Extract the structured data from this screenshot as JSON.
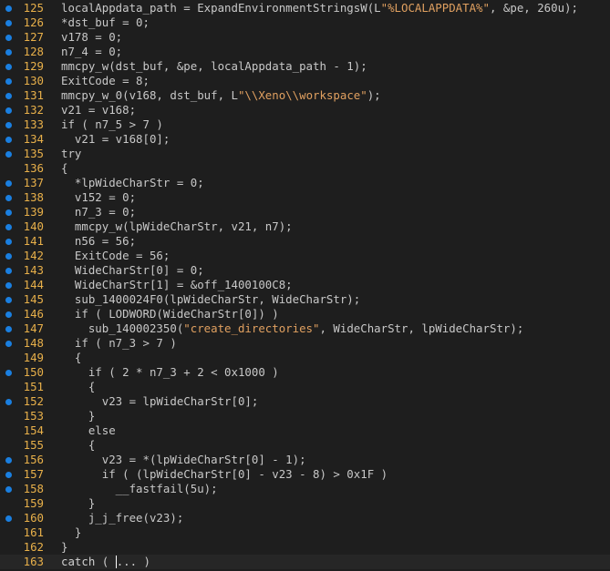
{
  "editor": {
    "lines": [
      {
        "n": "125",
        "bp": true,
        "code": "localAppdata_path = ExpandEnvironmentStringsW(L\"%LOCALAPPDATA%\", &pe, 260u);"
      },
      {
        "n": "126",
        "bp": true,
        "code": "*dst_buf = 0;"
      },
      {
        "n": "127",
        "bp": true,
        "code": "v178 = 0;"
      },
      {
        "n": "128",
        "bp": true,
        "code": "n7_4 = 0;"
      },
      {
        "n": "129",
        "bp": true,
        "code": "mmcpy_w(dst_buf, &pe, localAppdata_path - 1);"
      },
      {
        "n": "130",
        "bp": true,
        "code": "ExitCode = 8;"
      },
      {
        "n": "131",
        "bp": true,
        "code": "mmcpy_w_0(v168, dst_buf, L\"\\\\Xeno\\\\workspace\");"
      },
      {
        "n": "132",
        "bp": true,
        "code": "v21 = v168;"
      },
      {
        "n": "133",
        "bp": true,
        "code": "if ( n7_5 > 7 )"
      },
      {
        "n": "134",
        "bp": true,
        "code": "  v21 = v168[0];"
      },
      {
        "n": "135",
        "bp": true,
        "code": "try"
      },
      {
        "n": "136",
        "bp": false,
        "code": "{"
      },
      {
        "n": "137",
        "bp": true,
        "code": "  *lpWideCharStr = 0;"
      },
      {
        "n": "138",
        "bp": true,
        "code": "  v152 = 0;"
      },
      {
        "n": "139",
        "bp": true,
        "code": "  n7_3 = 0;"
      },
      {
        "n": "140",
        "bp": true,
        "code": "  mmcpy_w(lpWideCharStr, v21, n7);"
      },
      {
        "n": "141",
        "bp": true,
        "code": "  n56 = 56;"
      },
      {
        "n": "142",
        "bp": true,
        "code": "  ExitCode = 56;"
      },
      {
        "n": "143",
        "bp": true,
        "code": "  WideCharStr[0] = 0;"
      },
      {
        "n": "144",
        "bp": true,
        "code": "  WideCharStr[1] = &off_1400100C8;"
      },
      {
        "n": "145",
        "bp": true,
        "code": "  sub_1400024F0(lpWideCharStr, WideCharStr);"
      },
      {
        "n": "146",
        "bp": true,
        "code": "  if ( LODWORD(WideCharStr[0]) )"
      },
      {
        "n": "147",
        "bp": true,
        "code": "    sub_140002350(\"create_directories\", WideCharStr, lpWideCharStr);"
      },
      {
        "n": "148",
        "bp": true,
        "code": "  if ( n7_3 > 7 )"
      },
      {
        "n": "149",
        "bp": false,
        "code": "  {"
      },
      {
        "n": "150",
        "bp": true,
        "code": "    if ( 2 * n7_3 + 2 < 0x1000 )"
      },
      {
        "n": "151",
        "bp": false,
        "code": "    {"
      },
      {
        "n": "152",
        "bp": true,
        "code": "      v23 = lpWideCharStr[0];"
      },
      {
        "n": "153",
        "bp": false,
        "code": "    }"
      },
      {
        "n": "154",
        "bp": false,
        "code": "    else"
      },
      {
        "n": "155",
        "bp": false,
        "code": "    {"
      },
      {
        "n": "156",
        "bp": true,
        "code": "      v23 = *(lpWideCharStr[0] - 1);"
      },
      {
        "n": "157",
        "bp": true,
        "code": "      if ( (lpWideCharStr[0] - v23 - 8) > 0x1F )"
      },
      {
        "n": "158",
        "bp": true,
        "code": "        __fastfail(5u);"
      },
      {
        "n": "159",
        "bp": false,
        "code": "    }"
      },
      {
        "n": "160",
        "bp": true,
        "code": "    j_j_free(v23);"
      },
      {
        "n": "161",
        "bp": false,
        "code": "  }"
      },
      {
        "n": "162",
        "bp": false,
        "code": "}"
      },
      {
        "n": "163",
        "bp": false,
        "code": "catch ( ... )",
        "current": true
      }
    ],
    "colors": {
      "background": "#1e1e1e",
      "line_number": "#e8b04a",
      "breakpoint_dot": "#1a7fe0",
      "string": "#e0a060",
      "text": "#cfcfcf"
    }
  }
}
